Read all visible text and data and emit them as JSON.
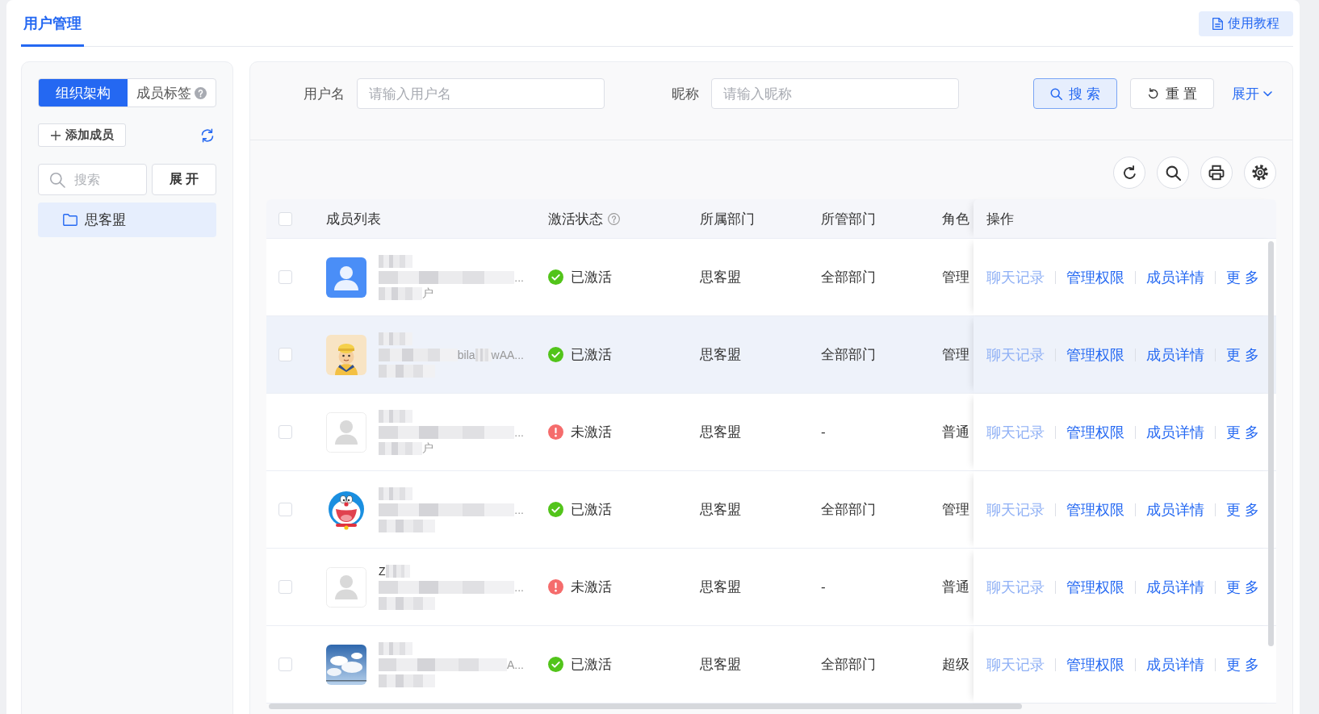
{
  "tabs": [
    {
      "label": "用户管理",
      "selected": true
    }
  ],
  "tutorial_button": "使用教程",
  "sidebar": {
    "modes": [
      {
        "label": "组织架构",
        "selected": true
      },
      {
        "label": "成员标签",
        "selected": false,
        "help": true
      }
    ],
    "add_button": "添加成员",
    "search": {
      "placeholder": "搜索"
    },
    "expand_button": "展 开",
    "tree": [
      {
        "label": "思客盟",
        "selected": true
      }
    ]
  },
  "filters": {
    "fields": [
      {
        "label": "用户名",
        "placeholder": "请输入用户名"
      },
      {
        "label": "昵称",
        "placeholder": "请输入昵称"
      }
    ],
    "search_button": "搜 索",
    "reset_button": "重 置",
    "expand_link": "展开"
  },
  "table": {
    "select_all": {
      "checked": false
    },
    "columns": [
      {
        "label": "成员列表"
      },
      {
        "label": "激活状态",
        "help": true
      },
      {
        "label": "所属部门"
      },
      {
        "label": "所管部门"
      },
      {
        "label": "角色"
      },
      {
        "label": "操作"
      }
    ],
    "rows": [
      {
        "checked": false,
        "highlighted": false,
        "avatar": {
          "kind": "default"
        },
        "second_line": [
          "..."
        ],
        "third_line": [
          "户"
        ],
        "status": "已激活",
        "activated": true,
        "department": "思客盟",
        "managed_department": "全部部门",
        "role": "管理",
        "actions": [
          {
            "label": "聊天记录",
            "disabled": true
          },
          {
            "label": "管理权限",
            "disabled": false
          },
          {
            "label": "成员详情",
            "disabled": false
          },
          {
            "label": "更 多",
            "disabled": false
          }
        ]
      },
      {
        "checked": false,
        "highlighted": true,
        "avatar": {
          "kind": "cartoon"
        },
        "second_line": [
          "bila",
          "wAA..."
        ],
        "status": "已激活",
        "activated": true,
        "department": "思客盟",
        "managed_department": "全部部门",
        "role": "管理",
        "actions": [
          {
            "label": "聊天记录",
            "disabled": true
          },
          {
            "label": "管理权限",
            "disabled": false
          },
          {
            "label": "成员详情",
            "disabled": false
          },
          {
            "label": "更 多",
            "disabled": false
          }
        ]
      },
      {
        "checked": false,
        "highlighted": false,
        "avatar": {
          "kind": "placeholder"
        },
        "second_line": [
          "..."
        ],
        "third_line": [
          "户"
        ],
        "status": "未激活",
        "activated": false,
        "department": "思客盟",
        "managed_department": "-",
        "role": "普通",
        "actions": [
          {
            "label": "聊天记录",
            "disabled": true
          },
          {
            "label": "管理权限",
            "disabled": false
          },
          {
            "label": "成员详情",
            "disabled": false
          },
          {
            "label": "更 多",
            "disabled": false
          }
        ]
      },
      {
        "checked": false,
        "highlighted": false,
        "avatar": {
          "kind": "cat"
        },
        "second_line": [
          "..."
        ],
        "status": "已激活",
        "activated": true,
        "department": "思客盟",
        "managed_department": "全部部门",
        "role": "管理",
        "actions": [
          {
            "label": "聊天记录",
            "disabled": true
          },
          {
            "label": "管理权限",
            "disabled": false
          },
          {
            "label": "成员详情",
            "disabled": false
          },
          {
            "label": "更 多",
            "disabled": false
          }
        ]
      },
      {
        "checked": false,
        "highlighted": false,
        "avatar": {
          "kind": "placeholder"
        },
        "first_line": [
          "Z"
        ],
        "second_line": [
          "..."
        ],
        "status": "未激活",
        "activated": false,
        "department": "思客盟",
        "managed_department": "-",
        "role": "普通",
        "actions": [
          {
            "label": "聊天记录",
            "disabled": true
          },
          {
            "label": "管理权限",
            "disabled": false
          },
          {
            "label": "成员详情",
            "disabled": false
          },
          {
            "label": "更 多",
            "disabled": false
          }
        ]
      },
      {
        "checked": false,
        "highlighted": false,
        "avatar": {
          "kind": "photo"
        },
        "second_line": [
          "A..."
        ],
        "status": "已激活",
        "activated": true,
        "department": "思客盟",
        "managed_department": "全部部门",
        "role": "超级",
        "actions": [
          {
            "label": "聊天记录",
            "disabled": true
          },
          {
            "label": "管理权限",
            "disabled": false
          },
          {
            "label": "成员详情",
            "disabled": false
          },
          {
            "label": "更 多",
            "disabled": false
          }
        ]
      }
    ]
  }
}
